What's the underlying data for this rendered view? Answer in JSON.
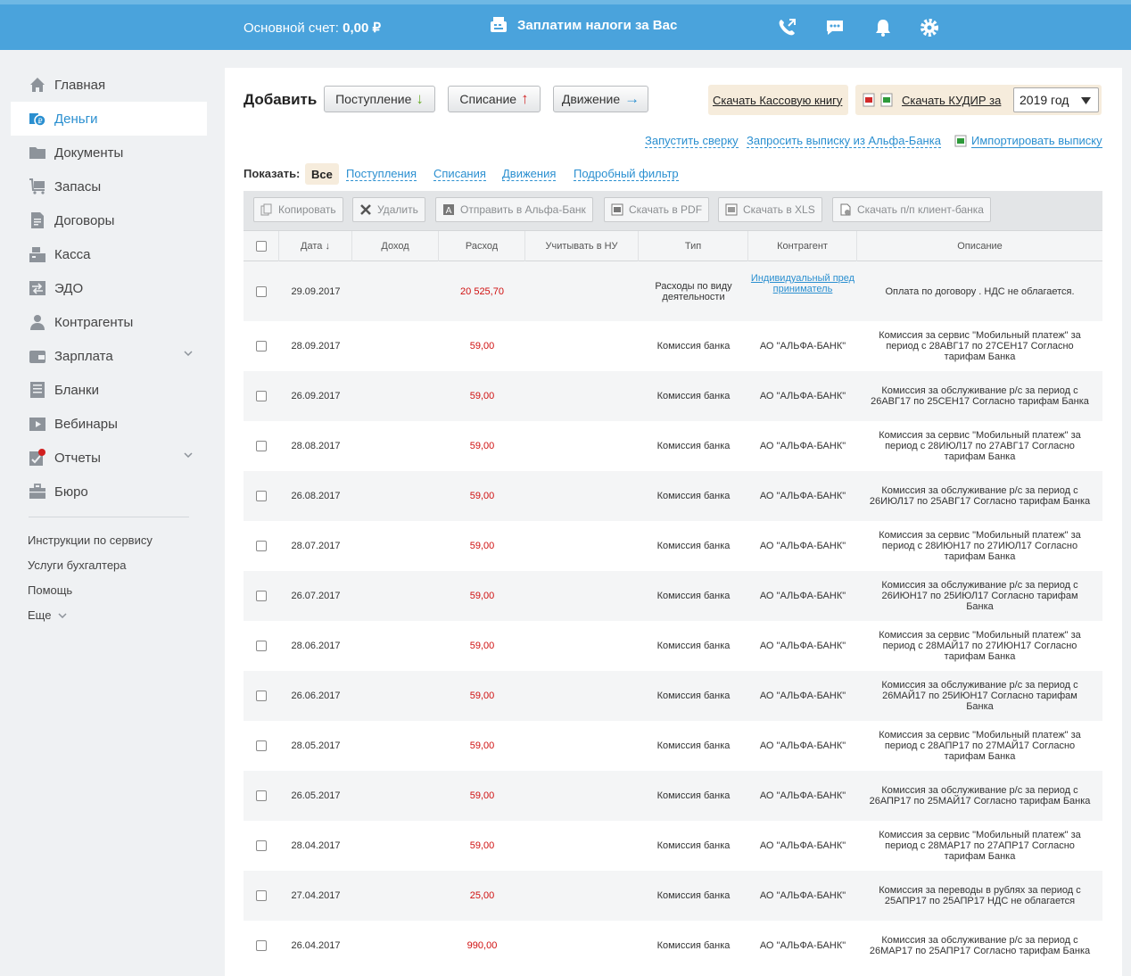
{
  "topbar": {
    "balance_label": "Основной счет:",
    "balance_value": "0,00 ₽",
    "promo": "Заплатим налоги за Вас",
    "icons": [
      "phone-icon",
      "chat-icon",
      "bell-icon",
      "settings-icon"
    ]
  },
  "sidebar": {
    "items": [
      {
        "label": "Главная",
        "icon": "home-icon"
      },
      {
        "label": "Деньги",
        "icon": "money-icon",
        "active": true
      },
      {
        "label": "Документы",
        "icon": "folder-icon"
      },
      {
        "label": "Запасы",
        "icon": "cart-icon"
      },
      {
        "label": "Договоры",
        "icon": "contract-icon"
      },
      {
        "label": "Касса",
        "icon": "cash-register-icon"
      },
      {
        "label": "ЭДО",
        "icon": "edo-icon"
      },
      {
        "label": "Контрагенты",
        "icon": "person-icon"
      },
      {
        "label": "Зарплата",
        "icon": "wallet-icon",
        "expandable": true
      },
      {
        "label": "Бланки",
        "icon": "form-icon"
      },
      {
        "label": "Вебинары",
        "icon": "video-icon"
      },
      {
        "label": "Отчеты",
        "icon": "report-icon",
        "expandable": true,
        "badge": true
      },
      {
        "label": "Бюро",
        "icon": "briefcase-icon"
      }
    ],
    "links": [
      "Инструкции по сервису",
      "Услуги бухгалтера",
      "Помощь",
      "Еще"
    ]
  },
  "actions": {
    "add_label": "Добавить",
    "income_button": "Поступление",
    "expense_button": "Списание",
    "movement_button": "Движение",
    "cashbook_link": "Скачать Кассовую книгу",
    "kudir_link": "Скачать КУДИР за",
    "year_select": "2019 год",
    "run_check": "Запустить сверку",
    "request_statement": "Запросить выписку из Альфа-Банка",
    "import_statement": "Импортировать выписку"
  },
  "filters": {
    "label": "Показать:",
    "all": "Все",
    "income": "Поступления",
    "expense": "Списания",
    "movement": "Движения",
    "detailed": "Подробный фильтр"
  },
  "toolbar": {
    "copy": "Копировать",
    "delete": "Удалить",
    "send_alfa": "Отправить в Альфа-Банк",
    "download_pdf": "Скачать в PDF",
    "download_xls": "Скачать в XLS",
    "download_pp": "Скачать п/п клиент-банка"
  },
  "table": {
    "columns": {
      "date": "Дата ↓",
      "income": "Доход",
      "expense": "Расход",
      "nu": "Учитывать в НУ",
      "type": "Тип",
      "counterparty": "Контрагент",
      "description": "Описание"
    },
    "rows": [
      {
        "date": "29.09.2017",
        "income": "",
        "expense": "20 525,70",
        "type": "Расходы по виду деятельности",
        "counterparty": "Индивидуальный пред приниматель",
        "counterparty_link": true,
        "description": "Оплата по договору . НДС не облагается."
      },
      {
        "date": "28.09.2017",
        "income": "",
        "expense": "59,00",
        "type": "Комиссия банка",
        "counterparty": "АО \"АЛЬФА-БАНК\"",
        "description": "Комиссия за сервис \"Мобильный платеж\" за период с 28АВГ17 по 27СЕН17 Согласно тарифам Банка"
      },
      {
        "date": "26.09.2017",
        "income": "",
        "expense": "59,00",
        "type": "Комиссия банка",
        "counterparty": "АО \"АЛЬФА-БАНК\"",
        "description": "Комиссия за обслуживание р/с за период с 26АВГ17 по 25СЕН17 Согласно тарифам Банка"
      },
      {
        "date": "28.08.2017",
        "income": "",
        "expense": "59,00",
        "type": "Комиссия банка",
        "counterparty": "АО \"АЛЬФА-БАНК\"",
        "description": "Комиссия за сервис \"Мобильный платеж\" за период с 28ИЮЛ17 по 27АВГ17 Согласно тарифам Банка"
      },
      {
        "date": "26.08.2017",
        "income": "",
        "expense": "59,00",
        "type": "Комиссия банка",
        "counterparty": "АО \"АЛЬФА-БАНК\"",
        "description": "Комиссия за обслуживание р/с за период с 26ИЮЛ17 по 25АВГ17 Согласно тарифам Банка"
      },
      {
        "date": "28.07.2017",
        "income": "",
        "expense": "59,00",
        "type": "Комиссия банка",
        "counterparty": "АО \"АЛЬФА-БАНК\"",
        "description": "Комиссия за сервис \"Мобильный платеж\" за период с 28ИЮН17 по 27ИЮЛ17 Согласно тарифам Банка"
      },
      {
        "date": "26.07.2017",
        "income": "",
        "expense": "59,00",
        "type": "Комиссия банка",
        "counterparty": "АО \"АЛЬФА-БАНК\"",
        "description": "Комиссия за обслуживание р/с за период с 26ИЮН17 по 25ИЮЛ17 Согласно тарифам Банка"
      },
      {
        "date": "28.06.2017",
        "income": "",
        "expense": "59,00",
        "type": "Комиссия банка",
        "counterparty": "АО \"АЛЬФА-БАНК\"",
        "description": "Комиссия за сервис \"Мобильный платеж\" за период с 28МАЙ17 по 27ИЮН17 Согласно тарифам Банка"
      },
      {
        "date": "26.06.2017",
        "income": "",
        "expense": "59,00",
        "type": "Комиссия банка",
        "counterparty": "АО \"АЛЬФА-БАНК\"",
        "description": "Комиссия за обслуживание р/с за период с 26МАЙ17 по 25ИЮН17 Согласно тарифам Банка"
      },
      {
        "date": "28.05.2017",
        "income": "",
        "expense": "59,00",
        "type": "Комиссия банка",
        "counterparty": "АО \"АЛЬФА-БАНК\"",
        "description": "Комиссия за сервис \"Мобильный платеж\" за период с 28АПР17 по 27МАЙ17 Согласно тарифам Банка"
      },
      {
        "date": "26.05.2017",
        "income": "",
        "expense": "59,00",
        "type": "Комиссия банка",
        "counterparty": "АО \"АЛЬФА-БАНК\"",
        "description": "Комиссия за обслуживание р/с за период с 26АПР17 по 25МАЙ17 Согласно тарифам Банка"
      },
      {
        "date": "28.04.2017",
        "income": "",
        "expense": "59,00",
        "type": "Комиссия банка",
        "counterparty": "АО \"АЛЬФА-БАНК\"",
        "description": "Комиссия за сервис \"Мобильный платеж\" за период с 28МАР17 по 27АПР17 Согласно тарифам Банка"
      },
      {
        "date": "27.04.2017",
        "income": "",
        "expense": "25,00",
        "type": "Комиссия банка",
        "counterparty": "АО \"АЛЬФА-БАНК\"",
        "description": "Комиссия за переводы в рублях за период с 25АПР17 по 25АПР17 НДС не облагается"
      },
      {
        "date": "26.04.2017",
        "income": "",
        "expense": "990,00",
        "type": "Комиссия банка",
        "counterparty": "АО \"АЛЬФА-БАНК\"",
        "description": "Комиссия за обслуживание р/с за период с 26МАР17 по 25АПР17 Согласно тарифам Банка"
      }
    ]
  },
  "colors": {
    "topbar": "#4aa3dc",
    "accent": "#2a8fd0",
    "expense": "#d01010",
    "highlight": "#f6ecdc"
  }
}
